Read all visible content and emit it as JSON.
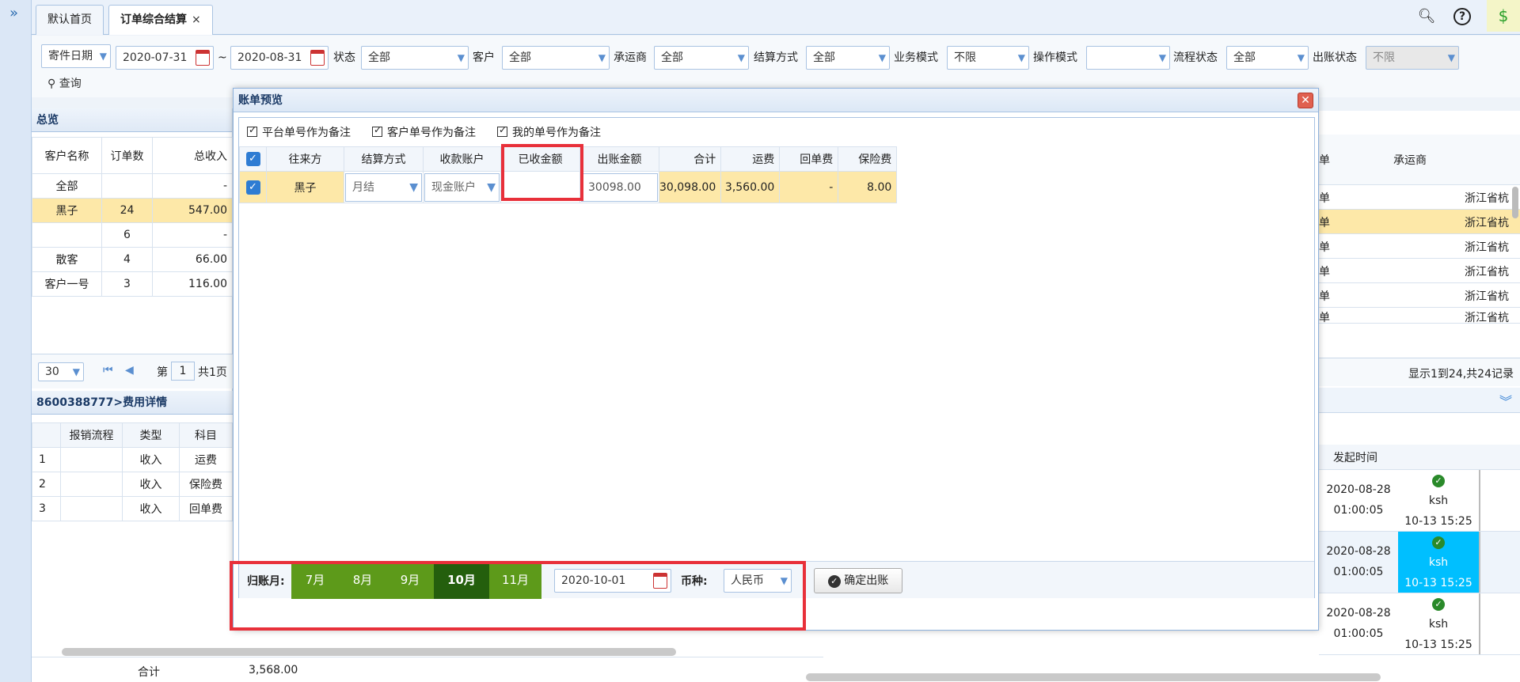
{
  "tabs": [
    {
      "label": "默认首页"
    },
    {
      "label": "订单综合结算",
      "close": "×"
    }
  ],
  "filter": {
    "date_type": "寄件日期",
    "date_from": "2020-07-31",
    "tilde": "~",
    "date_to": "2020-08-31",
    "status_label": "状态",
    "status_value": "全部",
    "customer_label": "客户",
    "customer_value": "全部",
    "carrier_label": "承运商",
    "carrier_value": "全部",
    "settle_label": "结算方式",
    "settle_value": "全部",
    "biz_label": "业务模式",
    "biz_value": "不限",
    "op_label": "操作模式",
    "op_value": "",
    "flow_label": "流程状态",
    "flow_value": "全部",
    "bill_label": "出账状态",
    "bill_value": "不限",
    "query": "查询"
  },
  "overview": {
    "title": "总览",
    "headers": [
      "客户名称",
      "订单数",
      "总收入"
    ],
    "rows": [
      {
        "name": "全部",
        "count": "",
        "income": "-"
      },
      {
        "name": "黑子",
        "count": "24",
        "income": "547.00"
      },
      {
        "name": "",
        "count": "6",
        "income": "-"
      },
      {
        "name": "散客",
        "count": "4",
        "income": "66.00"
      },
      {
        "name": "客户一号",
        "count": "3",
        "income": "116.00"
      }
    ],
    "page_size": "30",
    "page_prefix": "第",
    "page_no": "1",
    "page_suffix": "共1页"
  },
  "right_grid": {
    "header_carrier": "承运商",
    "col_frag": "单",
    "row_frag": "单",
    "carrier_frag": "浙江省杭",
    "records": "显示1到24,共24记录"
  },
  "details": {
    "title": "8600388777>费用详情",
    "headers": [
      "报销流程",
      "类型",
      "科目"
    ],
    "rows": [
      {
        "no": "1",
        "type": "收入",
        "item": "运费"
      },
      {
        "no": "2",
        "type": "收入",
        "item": "保险费"
      },
      {
        "no": "3",
        "type": "收入",
        "item": "回单费"
      }
    ],
    "total_label": "合计",
    "total_value": "3,568.00"
  },
  "timeline": {
    "header": "发起时间",
    "rows": [
      {
        "date": "2020-08-28",
        "time": "01:00:05",
        "user": "ksh",
        "stamp": "10-13 15:25"
      },
      {
        "date": "2020-08-28",
        "time": "01:00:05",
        "user": "ksh",
        "stamp": "10-13 15:25"
      },
      {
        "date": "2020-08-28",
        "time": "01:00:05",
        "user": "ksh",
        "stamp": "10-13 15:25"
      }
    ]
  },
  "modal": {
    "title": "账单预览",
    "opt1": "平台单号作为备注",
    "opt2": "客户单号作为备注",
    "opt3": "我的单号作为备注",
    "headers": [
      "往来方",
      "结算方式",
      "收款账户",
      "已收金额",
      "出账金额",
      "合计",
      "运费",
      "回单费",
      "保险费"
    ],
    "row": {
      "party": "黑子",
      "settle": "月结",
      "account": "现金账户",
      "received": "",
      "bill_amount": "30098.00",
      "total": "30,098.00",
      "freight": "3,560.00",
      "receipt": "-",
      "insurance": "8.00"
    },
    "period_label": "归账月:",
    "months": [
      "7月",
      "8月",
      "9月",
      "10月",
      "11月"
    ],
    "selected_month": "10月",
    "period_date": "2020-10-01",
    "currency_label": "币种:",
    "currency": "人民币",
    "confirm": "确定出账"
  },
  "colors": {
    "accent": "#2e7cd3",
    "highlight": "#fde8a8",
    "month_green": "#5d9a1a",
    "month_selected": "#245f0d",
    "annotation_red": "#e8303a"
  }
}
